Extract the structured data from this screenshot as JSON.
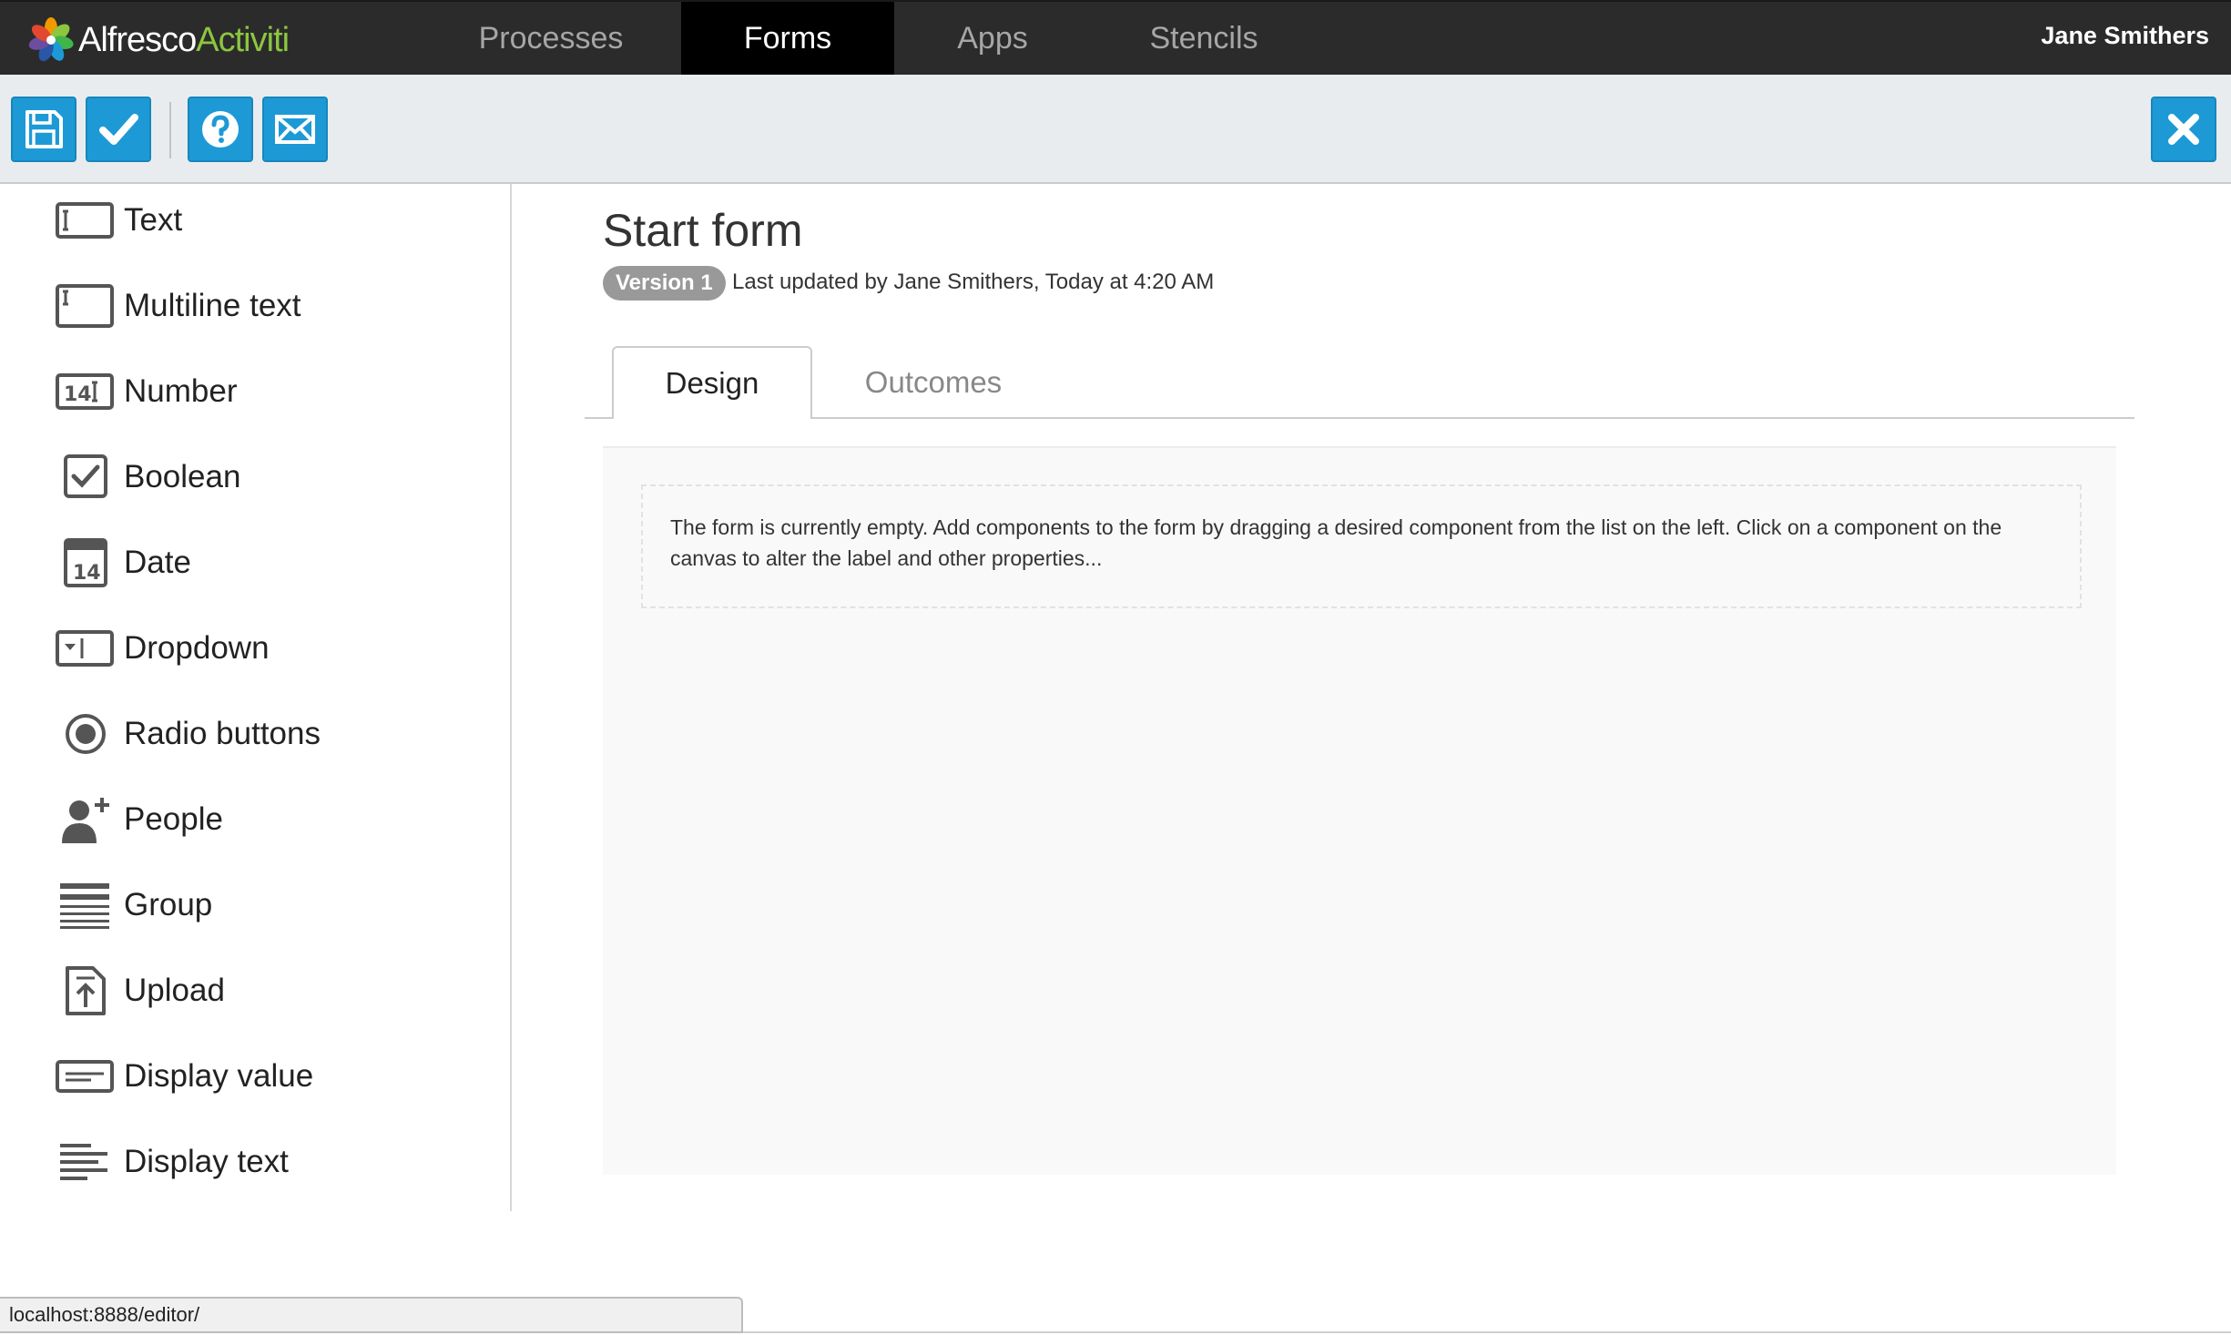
{
  "topbar": {
    "logo_brand": "Alfresco",
    "logo_product": "Activiti",
    "tabs": [
      {
        "label": "Processes"
      },
      {
        "label": "Forms"
      },
      {
        "label": "Apps"
      },
      {
        "label": "Stencils"
      }
    ],
    "active_tab": "Forms",
    "user_name": "Jane Smithers"
  },
  "toolbar": {
    "buttons": [
      {
        "icon": "floppy-disk-icon",
        "action": "save"
      },
      {
        "icon": "checkmark-icon",
        "action": "validate"
      },
      {
        "icon": "question-icon",
        "action": "help"
      },
      {
        "icon": "envelope-icon",
        "action": "feedback"
      }
    ],
    "close_icon": "close-icon",
    "accent_color": "#1d9ad6"
  },
  "palette": {
    "items": [
      {
        "label": "Text",
        "icon": "text-field-icon"
      },
      {
        "label": "Multiline text",
        "icon": "multiline-text-icon"
      },
      {
        "label": "Number",
        "icon": "number-icon"
      },
      {
        "label": "Boolean",
        "icon": "checkbox-icon"
      },
      {
        "label": "Date",
        "icon": "calendar-icon"
      },
      {
        "label": "Dropdown",
        "icon": "dropdown-icon"
      },
      {
        "label": "Radio buttons",
        "icon": "radio-icon"
      },
      {
        "label": "People",
        "icon": "add-person-icon"
      },
      {
        "label": "Group",
        "icon": "group-icon"
      },
      {
        "label": "Upload",
        "icon": "upload-icon"
      },
      {
        "label": "Display value",
        "icon": "display-value-icon"
      },
      {
        "label": "Display text",
        "icon": "display-text-icon"
      }
    ]
  },
  "form": {
    "title": "Start form",
    "version": "Version 1",
    "meta": "Last updated by Jane Smithers, Today at 4:20 AM",
    "tabs": [
      {
        "label": "Design"
      },
      {
        "label": "Outcomes"
      }
    ],
    "active_tab": "Design",
    "empty_hint": "The form is currently empty. Add components to the form by dragging a desired component from the list on the left. Click on a component on the canvas to alter the label and other properties..."
  },
  "status": {
    "url": "localhost:8888/editor/"
  }
}
